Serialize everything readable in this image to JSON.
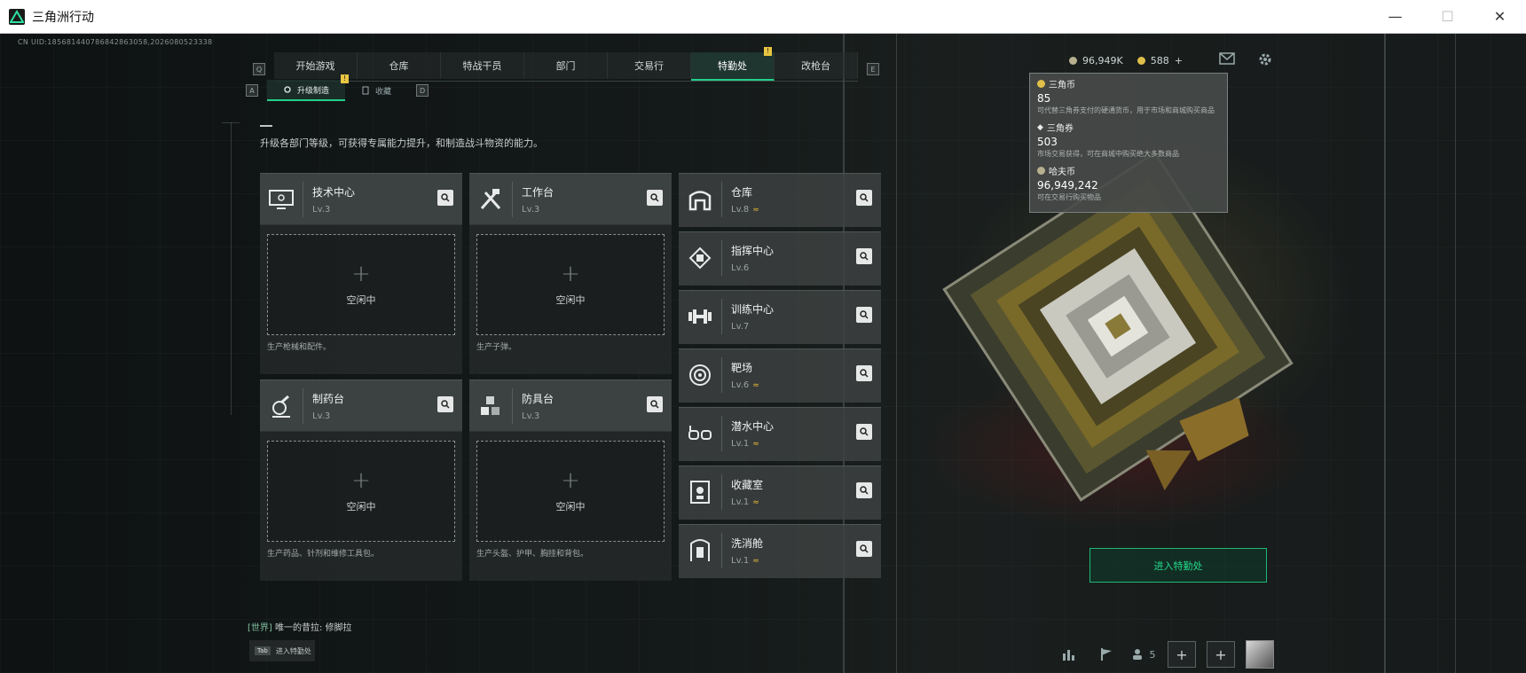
{
  "window": {
    "title": "三角洲行动",
    "min": "—",
    "max": "☐",
    "close": "✕"
  },
  "uid": "CN UID:185681440786842863058,2026080523338",
  "nav": {
    "left_key": "Q",
    "right_key": "E",
    "tabs": [
      {
        "label": "开始游戏"
      },
      {
        "label": "仓库"
      },
      {
        "label": "特战干员"
      },
      {
        "label": "部门"
      },
      {
        "label": "交易行"
      },
      {
        "label": "特勤处",
        "active": true,
        "badge": "!"
      },
      {
        "label": "改枪台"
      }
    ]
  },
  "subnav": {
    "left_key": "A",
    "right_key": "D",
    "tabs": [
      {
        "label": "升级制造",
        "active": true,
        "badge": "!"
      },
      {
        "label": "收藏"
      }
    ]
  },
  "intro": "升级各部门等级，可获得专属能力提升，和制造战斗物资的能力。",
  "production": [
    {
      "name": "技术中心",
      "level": "Lv.3",
      "icon": "computer-icon",
      "slot": "空闲中",
      "desc": "生产枪械和配件。"
    },
    {
      "name": "工作台",
      "level": "Lv.3",
      "icon": "tools-icon",
      "slot": "空闲中",
      "desc": "生产子弹。"
    },
    {
      "name": "制药台",
      "level": "Lv.3",
      "icon": "microscope-icon",
      "slot": "空闲中",
      "desc": "生产药品、针剂和维修工具包。"
    },
    {
      "name": "防具台",
      "level": "Lv.3",
      "icon": "blocks-icon",
      "slot": "空闲中",
      "desc": "生产头盔、护甲、胸挂和背包。"
    }
  ],
  "facilities": [
    {
      "name": "仓库",
      "level": "Lv.8",
      "upgradable": true,
      "icon": "warehouse-icon"
    },
    {
      "name": "指挥中心",
      "level": "Lv.6",
      "upgradable": false,
      "icon": "chip-icon"
    },
    {
      "name": "训练中心",
      "level": "Lv.7",
      "upgradable": false,
      "icon": "dumbbell-icon"
    },
    {
      "name": "靶场",
      "level": "Lv.6",
      "upgradable": true,
      "icon": "target-icon"
    },
    {
      "name": "潜水中心",
      "level": "Lv.1",
      "upgradable": true,
      "icon": "goggles-icon"
    },
    {
      "name": "收藏室",
      "level": "Lv.1",
      "upgradable": true,
      "icon": "trophy-icon"
    },
    {
      "name": "洗消舱",
      "level": "Lv.1",
      "upgradable": true,
      "icon": "shower-icon"
    }
  ],
  "upgrade_glyph": "≈",
  "currency": {
    "hafu_short": "96,949K",
    "coupon_short": "588",
    "plus": "+",
    "popup": [
      {
        "name": "三角币",
        "value": "85",
        "desc": "可代替三角券支付的硬通货币，用于市场和商城购买商品"
      },
      {
        "name": "三角券",
        "value": "503",
        "desc": "市场交易获得，可在商城中购买绝大多数商品"
      },
      {
        "name": "哈夫币",
        "value": "96,949,242",
        "desc": "可在交易行购买物品"
      }
    ]
  },
  "enter_button": "进入特勤处",
  "chat": {
    "channel": "[世界]",
    "text": "唯一的昔拉:",
    "user": "修脚拉"
  },
  "tab_hint": {
    "key": "Tab",
    "label": "进入特勤处"
  },
  "bottom": {
    "friends": "5"
  },
  "accent": "#22d08a",
  "upgrade_color": "#e3b93a"
}
